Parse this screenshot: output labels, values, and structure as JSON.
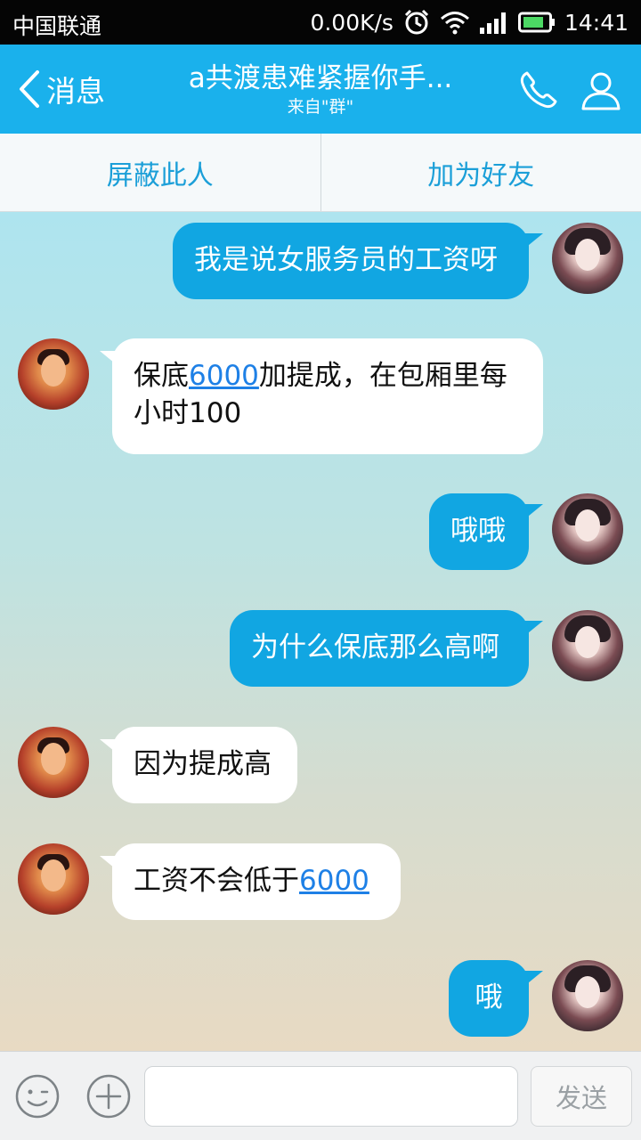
{
  "status_bar": {
    "carrier": "中国联通",
    "net_speed": "0.00K/s",
    "time": "14:41",
    "icons": [
      "alarm-icon",
      "wifi-icon",
      "signal-icon",
      "battery-icon"
    ]
  },
  "header": {
    "back_label": "消息",
    "title": "a共渡患难紧握你手...",
    "subtitle": "来自\"群\"",
    "icons": [
      "phone-icon",
      "profile-icon"
    ]
  },
  "actions": {
    "block": "屏蔽此人",
    "add_friend": "加为好友"
  },
  "messages": [
    {
      "sender": "self",
      "text": "我是说女服务员的工资呀"
    },
    {
      "sender": "other",
      "text_a": "保底",
      "link": "6000",
      "text_b": "加提成，在包厢里每",
      "text_c": "小时100"
    },
    {
      "sender": "self",
      "text": "哦哦"
    },
    {
      "sender": "self",
      "text": "为什么保底那么高啊"
    },
    {
      "sender": "other",
      "text": "因为提成高"
    },
    {
      "sender": "other",
      "text_a": "工资不会低于",
      "link": "6000"
    },
    {
      "sender": "self",
      "text": "哦"
    }
  ],
  "input_bar": {
    "icons": [
      "emoji-icon",
      "plus-icon"
    ],
    "send_label": "发送"
  },
  "colors": {
    "accent": "#1ab1ec",
    "self_bubble": "#11a6e2",
    "link": "#1e80e6"
  }
}
